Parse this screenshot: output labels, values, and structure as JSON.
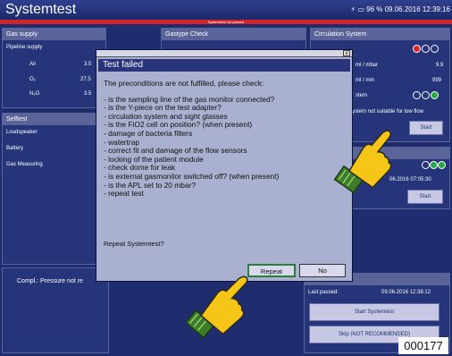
{
  "header": {
    "title": "Systemtest",
    "status_text": "96 %   09.06.2016  12:39:16",
    "banner": "Systemtest not passed"
  },
  "gas_supply": {
    "title": "Gas supply",
    "pipeline": "Pipeline supply",
    "rows": [
      {
        "label": "Air",
        "value": "3.5"
      },
      {
        "label": "O₂",
        "value": "27.5"
      },
      {
        "label": "N₂O",
        "value": "3.5"
      }
    ]
  },
  "gastype": {
    "title": "Gastype Check"
  },
  "circulation": {
    "title": "Circulation System",
    "row1_unit": "ml / mbar",
    "row1_value": "9.9",
    "row2_unit": "ml / min",
    "row2_value": "999",
    "row3": "stem",
    "note": "ystem not suitable for low flow",
    "start": "Start"
  },
  "selftest": {
    "title": "Selftest",
    "items": [
      "Loudspeaker",
      "Battery",
      "Gas Measuring"
    ]
  },
  "right_mid": {
    "datetime": "06.2016  07:05:30",
    "start": "Start"
  },
  "bottom_left": {
    "text": "Compl.: Pressure not re"
  },
  "bottom_right": {
    "last_label": "Last passed:",
    "last_value": "09.06.2016  12:38:12",
    "start_btn": "Start Systemtest",
    "skip_btn": "Skip (NOT RECOMMENDED)"
  },
  "dialog": {
    "title": "Test failed",
    "intro": "The preconditions are not fulfilled, please check:",
    "items": [
      "- is the sampling line of the gas monitor connected?",
      "- is the Y-piece on the test adapter?",
      "- circulation system and sight glasses",
      "- is the FiO2 cell on position? (when present)",
      "- damage of bacteria filters",
      "- watertrap",
      "- correct fit and damage of the flow sensors",
      "- locking of the patient module",
      "- check dome for leak",
      "- is external gasmonitor switched off? (when present)",
      "- is the APL set to 20 mbar?",
      "- repeat test"
    ],
    "question": "Repeat Systemtest?",
    "repeat": "Repeat",
    "no": "No"
  },
  "code": "000177"
}
